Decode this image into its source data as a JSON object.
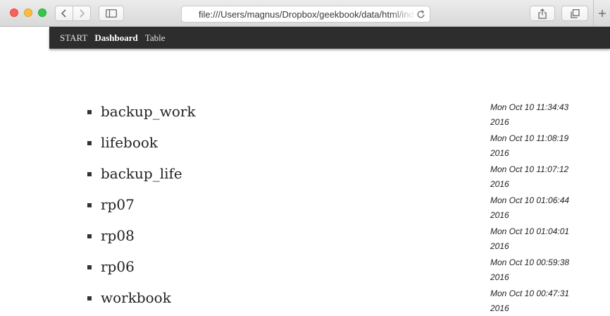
{
  "browser": {
    "url": "file:///Users/magnus/Dropbox/geekbook/data/html/index.html"
  },
  "nav": {
    "items": [
      {
        "label": "START",
        "active": false
      },
      {
        "label": "Dashboard",
        "active": true
      },
      {
        "label": "Table",
        "active": false
      }
    ]
  },
  "books": [
    {
      "name": "backup_work",
      "time_line1": "Mon Oct 10 11:34:43",
      "time_line2": "2016"
    },
    {
      "name": "lifebook",
      "time_line1": "Mon Oct 10 11:08:19",
      "time_line2": "2016"
    },
    {
      "name": "backup_life",
      "time_line1": "Mon Oct 10 11:07:12",
      "time_line2": "2016"
    },
    {
      "name": "rp07",
      "time_line1": "Mon Oct 10 01:06:44",
      "time_line2": "2016"
    },
    {
      "name": "rp08",
      "time_line1": "Mon Oct 10 01:04:01",
      "time_line2": "2016"
    },
    {
      "name": "rp06",
      "time_line1": "Mon Oct 10 00:59:38",
      "time_line2": "2016"
    },
    {
      "name": "workbook",
      "time_line1": "Mon Oct 10 00:47:31",
      "time_line2": "2016"
    }
  ],
  "colors": {
    "navbar_bg": "#2d2d2d",
    "close": "#fc605c",
    "minimize": "#fdbc40",
    "zoom": "#34c84a"
  },
  "icons": [
    "close-icon",
    "minimize-icon",
    "zoom-icon",
    "chevron-left-icon",
    "chevron-right-icon",
    "sidebar-icon",
    "reload-icon",
    "share-icon",
    "tabs-icon",
    "plus-icon"
  ]
}
